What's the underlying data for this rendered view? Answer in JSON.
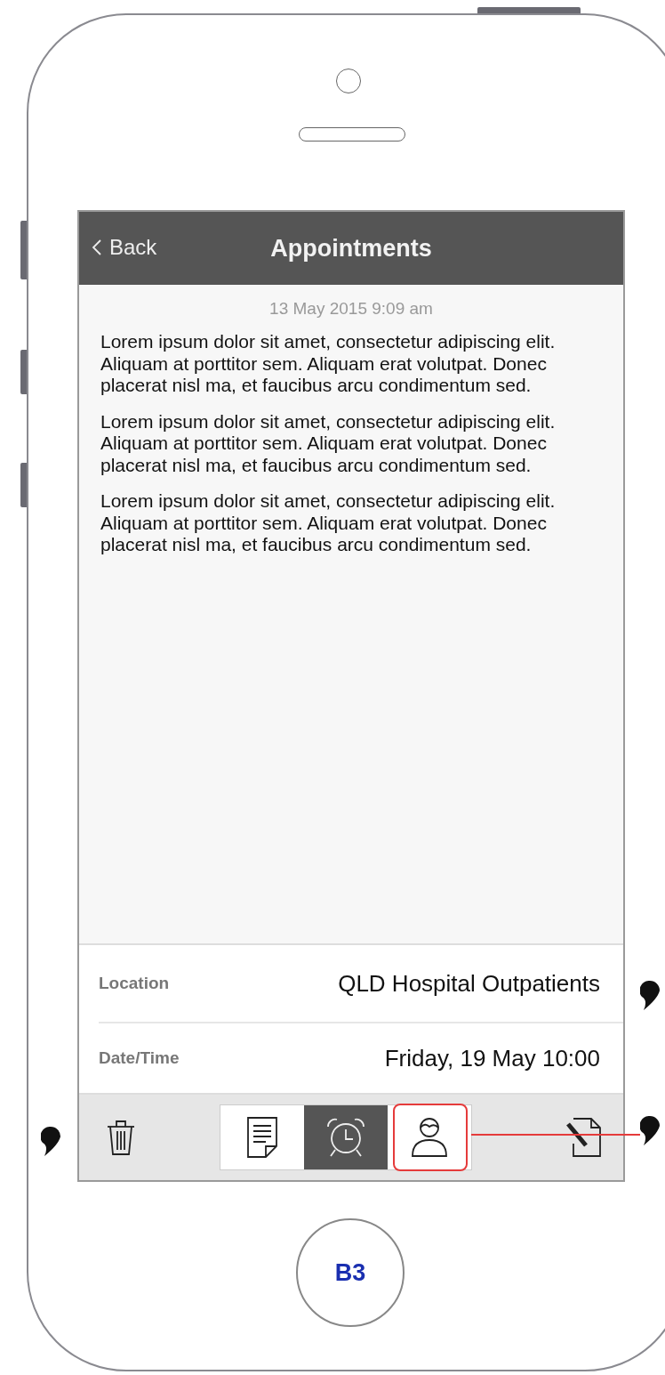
{
  "header": {
    "back_label": "Back",
    "title": "Appointments"
  },
  "timestamp": "13 May 2015 9:09 am",
  "paragraphs": [
    "Lorem ipsum dolor sit amet, consectetur adipiscing elit. Aliquam at porttitor sem. Aliquam erat volutpat. Donec placerat nisl ma, et faucibus arcu condimentum sed.",
    "Lorem ipsum dolor sit amet, consectetur adipiscing elit. Aliquam at porttitor sem. Aliquam erat volutpat. Donec placerat nisl ma, et faucibus arcu condimentum sed.",
    "Lorem ipsum dolor sit amet, consectetur adipiscing elit. Aliquam at porttitor sem. Aliquam erat volutpat. Donec placerat nisl ma, et faucibus arcu condimentum sed."
  ],
  "details": [
    {
      "label": "Location",
      "value": "QLD Hospital Outpatients"
    },
    {
      "label": "Date/Time",
      "value": "Friday, 19 May 10:00"
    }
  ],
  "segments": [
    {
      "kind": "notes",
      "selected": false,
      "annotated": false
    },
    {
      "kind": "alarm",
      "selected": true,
      "annotated": false
    },
    {
      "kind": "person",
      "selected": false,
      "annotated": true
    }
  ],
  "home_button": "B3"
}
